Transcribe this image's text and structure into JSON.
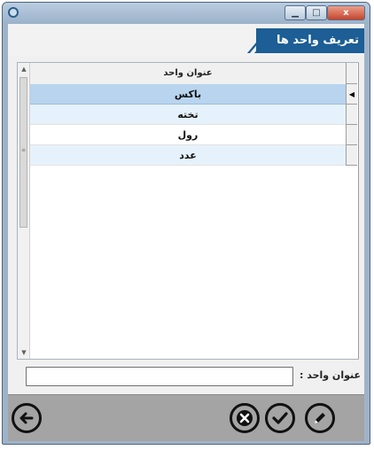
{
  "window": {
    "title": ""
  },
  "header": {
    "title": "تعریف واحد ها",
    "banner_color": "#1c5e95"
  },
  "grid": {
    "column_header": "عنوان واحد",
    "rows": [
      "باکس",
      "تخته",
      "رول",
      "عدد"
    ],
    "selected_index": 0,
    "row_indicator": "◀"
  },
  "form": {
    "label": "عنوان واحد :",
    "value": "",
    "placeholder": ""
  },
  "toolbar": {
    "buttons": [
      "back-arrow-icon",
      "cancel-x-icon",
      "confirm-check-icon",
      "edit-pencil-icon"
    ]
  },
  "titlebar_buttons": {
    "close": "x"
  }
}
